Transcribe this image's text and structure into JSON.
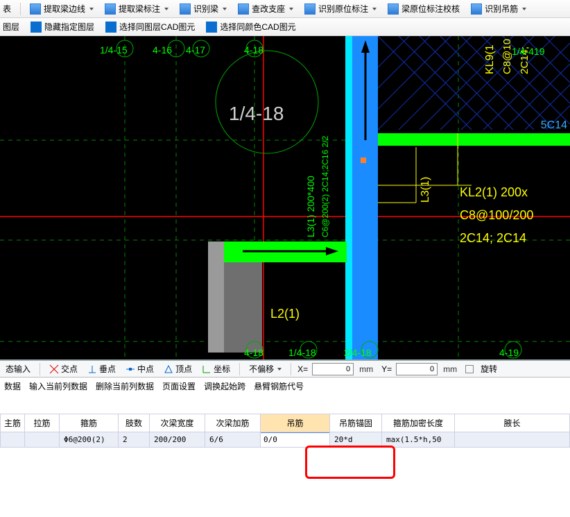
{
  "toolbar1": {
    "extract_edge": "提取梁边线",
    "extract_annot": "提取梁标注",
    "recognize_beam": "识别梁",
    "check_seat": "查改支座",
    "recognize_inplace": "识别原位标注",
    "verify_inplace": "梁原位标注校核",
    "recognize_diaojin": "识别吊筋"
  },
  "toolbar2": {
    "layer": "图层",
    "hide_layer": "隐藏指定图层",
    "pick_same_layer": "选择同图层CAD图元",
    "pick_same_color": "选择同颜色CAD图元"
  },
  "canvas": {
    "nodes_top": [
      "1/4-15",
      "4-16",
      "4-17",
      "4-18"
    ],
    "label_big": "1/4-18",
    "l3_text_a": "L3(1)  200*400",
    "l3_text_b": "C6@200(2)  2C14;2C16  2/2",
    "l3_right": "L3(1)",
    "kl9": "KL9(1",
    "kl9b": "C8@10",
    "kl9c": "2C14;",
    "top_right": "1/4-419",
    "fc14": "5C14",
    "kl2a": "KL2(1)   200x",
    "kl2b": "C8@100/200",
    "kl2c": "2C14; 2C14",
    "l2": "L2(1)",
    "nodes_bottom": [
      "4-18",
      "1/4-18",
      "2/4-18",
      "4-19"
    ]
  },
  "snap": {
    "dyn": "态输入",
    "jiao": "交点",
    "chui": "垂点",
    "zhong": "中点",
    "ding": "顶点",
    "zuobiao": "坐标",
    "noshift": "不偏移",
    "x_val": "0",
    "y_val": "0",
    "mm": "mm",
    "rotate": "旋转"
  },
  "databar": {
    "a": "数据",
    "b": "输入当前列数据",
    "c": "删除当前列数据",
    "d": "页面设置",
    "e": "调换起始跨",
    "f": "悬臂钢筋代号"
  },
  "table": {
    "headers": [
      "主筋",
      "拉筋",
      "箍筋",
      "肢数",
      "次梁宽度",
      "次梁加筋",
      "吊筋",
      "吊筋锚固",
      "箍筋加密长度",
      "腋长"
    ],
    "row": {
      "gujin": "Φ6@200(2)",
      "zhishu": "2",
      "ciliangkuan": "200/200",
      "ciliangjia": "6/6",
      "diaojin": "0/0",
      "diaojinmao": "20*d",
      "jiami": "max(1.5*h,50"
    }
  }
}
